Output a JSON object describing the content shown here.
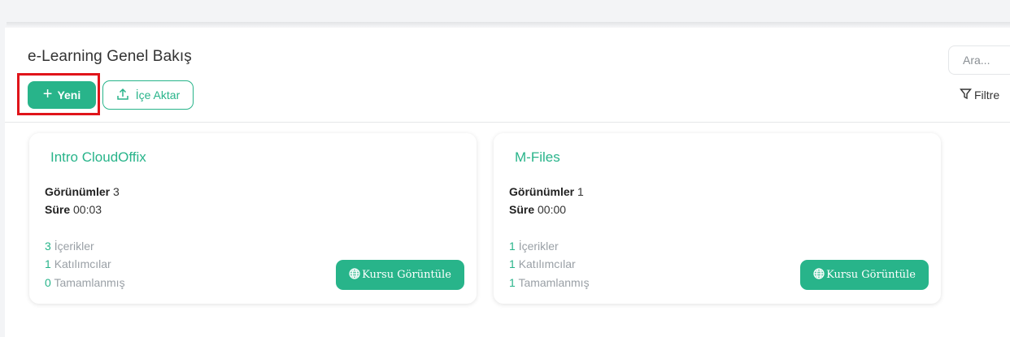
{
  "header": {
    "title": "e-Learning Genel Bakış",
    "new_button": "Yeni",
    "import_button": "İçe Aktar",
    "search_placeholder": "Ara...",
    "filter_label": "Filtre"
  },
  "courses": [
    {
      "title": "Intro CloudOffix",
      "views_label": "Görünümler",
      "views": "3",
      "duration_label": "Süre",
      "duration": "00:03",
      "contents_count": "3",
      "contents_label": "İçerikler",
      "participants_count": "1",
      "participants_label": "Katılımcılar",
      "completed_count": "0",
      "completed_label": "Tamamlanmış",
      "view_button": "Kursu Görüntüle"
    },
    {
      "title": "M-Files",
      "views_label": "Görünümler",
      "views": "1",
      "duration_label": "Süre",
      "duration": "00:00",
      "contents_count": "1",
      "contents_label": "İçerikler",
      "participants_count": "1",
      "participants_label": "Katılımcılar",
      "completed_count": "1",
      "completed_label": "Tamamlanmış",
      "view_button": "Kursu Görüntüle"
    }
  ],
  "colors": {
    "accent": "#28b48a",
    "highlight": "#e0141a"
  }
}
